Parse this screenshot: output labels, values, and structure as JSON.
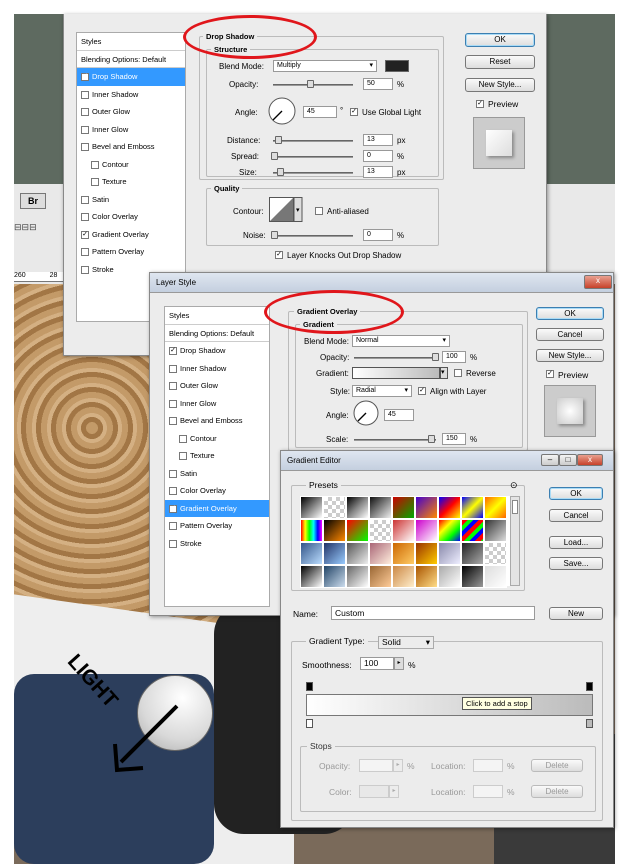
{
  "dialog1": {
    "styles_header": "Styles",
    "blending": "Blending Options: Default",
    "items": [
      {
        "label": "Drop Shadow",
        "checked": true,
        "selected": true,
        "indent": false
      },
      {
        "label": "Inner Shadow",
        "checked": false,
        "selected": false,
        "indent": false
      },
      {
        "label": "Outer Glow",
        "checked": false,
        "selected": false,
        "indent": false
      },
      {
        "label": "Inner Glow",
        "checked": false,
        "selected": false,
        "indent": false
      },
      {
        "label": "Bevel and Emboss",
        "checked": false,
        "selected": false,
        "indent": false
      },
      {
        "label": "Contour",
        "checked": false,
        "selected": false,
        "indent": true
      },
      {
        "label": "Texture",
        "checked": false,
        "selected": false,
        "indent": true
      },
      {
        "label": "Satin",
        "checked": false,
        "selected": false,
        "indent": false
      },
      {
        "label": "Color Overlay",
        "checked": false,
        "selected": false,
        "indent": false
      },
      {
        "label": "Gradient Overlay",
        "checked": true,
        "selected": false,
        "indent": false
      },
      {
        "label": "Pattern Overlay",
        "checked": false,
        "selected": false,
        "indent": false
      },
      {
        "label": "Stroke",
        "checked": false,
        "selected": false,
        "indent": false
      }
    ],
    "section_title": "Drop Shadow",
    "structure": "Structure",
    "blend_mode_label": "Blend Mode:",
    "blend_mode": "Multiply",
    "opacity_label": "Opacity:",
    "opacity": "50",
    "angle_label": "Angle:",
    "angle": "45",
    "use_global_light": "Use Global Light",
    "distance_label": "Distance:",
    "distance": "13",
    "spread_label": "Spread:",
    "spread": "0",
    "size_label": "Size:",
    "size": "13",
    "quality": "Quality",
    "contour_label": "Contour:",
    "anti_aliased": "Anti-aliased",
    "noise_label": "Noise:",
    "noise": "0",
    "knocks_out": "Layer Knocks Out Drop Shadow",
    "ok": "OK",
    "reset": "Reset",
    "new_style": "New Style...",
    "preview": "Preview",
    "unit_pct": "%",
    "unit_px": "px",
    "unit_deg": "°"
  },
  "dialog2": {
    "title": "Layer Style",
    "styles_header": "Styles",
    "blending": "Blending Options: Default",
    "items": [
      {
        "label": "Drop Shadow",
        "checked": true,
        "selected": false,
        "indent": false
      },
      {
        "label": "Inner Shadow",
        "checked": false,
        "selected": false,
        "indent": false
      },
      {
        "label": "Outer Glow",
        "checked": false,
        "selected": false,
        "indent": false
      },
      {
        "label": "Inner Glow",
        "checked": false,
        "selected": false,
        "indent": false
      },
      {
        "label": "Bevel and Emboss",
        "checked": false,
        "selected": false,
        "indent": false
      },
      {
        "label": "Contour",
        "checked": false,
        "selected": false,
        "indent": true
      },
      {
        "label": "Texture",
        "checked": false,
        "selected": false,
        "indent": true
      },
      {
        "label": "Satin",
        "checked": false,
        "selected": false,
        "indent": false
      },
      {
        "label": "Color Overlay",
        "checked": false,
        "selected": false,
        "indent": false
      },
      {
        "label": "Gradient Overlay",
        "checked": true,
        "selected": true,
        "indent": false
      },
      {
        "label": "Pattern Overlay",
        "checked": false,
        "selected": false,
        "indent": false
      },
      {
        "label": "Stroke",
        "checked": false,
        "selected": false,
        "indent": false
      }
    ],
    "section_title": "Gradient Overlay",
    "sub": "Gradient",
    "blend_mode_label": "Blend Mode:",
    "blend_mode": "Normal",
    "opacity_label": "Opacity:",
    "opacity": "100",
    "gradient_label": "Gradient:",
    "reverse": "Reverse",
    "style_label": "Style:",
    "style": "Radial",
    "align": "Align with Layer",
    "angle_label": "Angle:",
    "angle": "45",
    "scale_label": "Scale:",
    "scale": "150",
    "ok": "OK",
    "cancel": "Cancel",
    "new_style": "New Style...",
    "preview": "Preview",
    "close": "x"
  },
  "gradient_editor": {
    "title": "Gradient Editor",
    "presets": "Presets",
    "ok": "OK",
    "cancel": "Cancel",
    "load": "Load...",
    "save": "Save...",
    "name_label": "Name:",
    "name": "Custom",
    "new": "New",
    "type_label": "Gradient Type:",
    "type": "Solid",
    "smoothness_label": "Smoothness:",
    "smoothness": "100",
    "pct": "%",
    "tooltip": "Click to add a stop",
    "stops": "Stops",
    "opacity_label": "Opacity:",
    "color_label": "Color:",
    "location_label": "Location:",
    "delete": "Delete"
  },
  "bg": {
    "br": "Br",
    "ruler1": "260",
    "ruler2": "28",
    "light": "LIGHT"
  }
}
